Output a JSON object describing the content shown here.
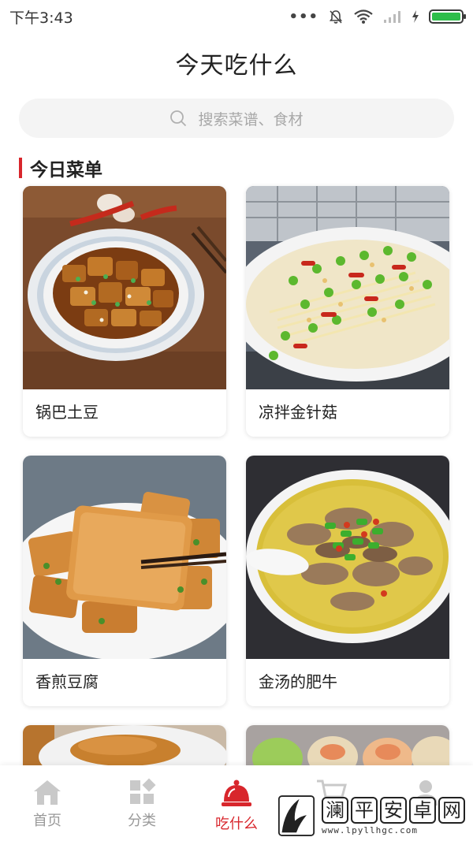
{
  "status_bar": {
    "time": "下午3:43"
  },
  "header": {
    "title": "今天吃什么"
  },
  "search": {
    "placeholder": "搜索菜谱、食材"
  },
  "section": {
    "title": "今日菜单"
  },
  "dishes": [
    {
      "name": "锅巴土豆"
    },
    {
      "name": "凉拌金针菇"
    },
    {
      "name": "香煎豆腐"
    },
    {
      "name": "金汤的肥牛"
    }
  ],
  "nav": {
    "items": [
      {
        "label": "首页",
        "icon": "home-icon"
      },
      {
        "label": "分类",
        "icon": "category-icon"
      },
      {
        "label": "吃什么",
        "icon": "cloche-icon",
        "active": true
      },
      {
        "label": "",
        "icon": "cart-icon"
      },
      {
        "label": "",
        "icon": "user-icon"
      }
    ]
  },
  "watermark": {
    "chars": [
      "澜",
      "平",
      "安",
      "卓",
      "网"
    ],
    "url": "www.lpyllhgc.com"
  },
  "colors": {
    "accent": "#d8262c",
    "battery": "#2ebd4a"
  }
}
